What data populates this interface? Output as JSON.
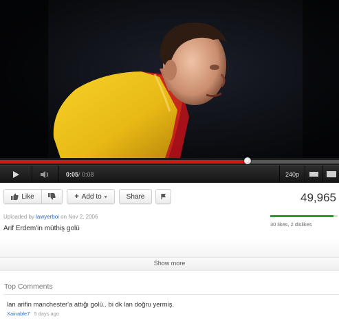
{
  "player": {
    "current_time": "0:05",
    "duration": "0:08",
    "time_separator": " / ",
    "progress_fraction": 0.73,
    "quality": "240p"
  },
  "actions": {
    "like_label": "Like",
    "add_to_label": "Add to",
    "share_label": "Share"
  },
  "stats": {
    "views": "49,965",
    "likes_summary": "30 likes, 2 dislikes",
    "like_fraction": 0.94
  },
  "upload": {
    "prefix": "Uploaded by ",
    "user": "lawyerboi",
    "date_text": " on Nov 2, 2006"
  },
  "description": "Arif Erdem'in müthiş golü",
  "show_more_label": "Show more",
  "comments": {
    "heading": "Top Comments",
    "items": [
      {
        "text": "lan arifin manchester'a attığı golü.. bi dk lan doğru yermiş.",
        "author": "Xainable7",
        "time": "5 days ago"
      }
    ]
  },
  "colors": {
    "progress_played": "#cc1b1b",
    "like_bar": "#2a9c2a",
    "link": "#2b6bc4",
    "jersey": "#f0c419"
  },
  "icons": [
    "play-icon",
    "volume-icon",
    "widescreen-icon",
    "fullscreen-icon",
    "thumbs-up-icon",
    "thumbs-down-icon",
    "plus-icon",
    "flag-icon"
  ]
}
